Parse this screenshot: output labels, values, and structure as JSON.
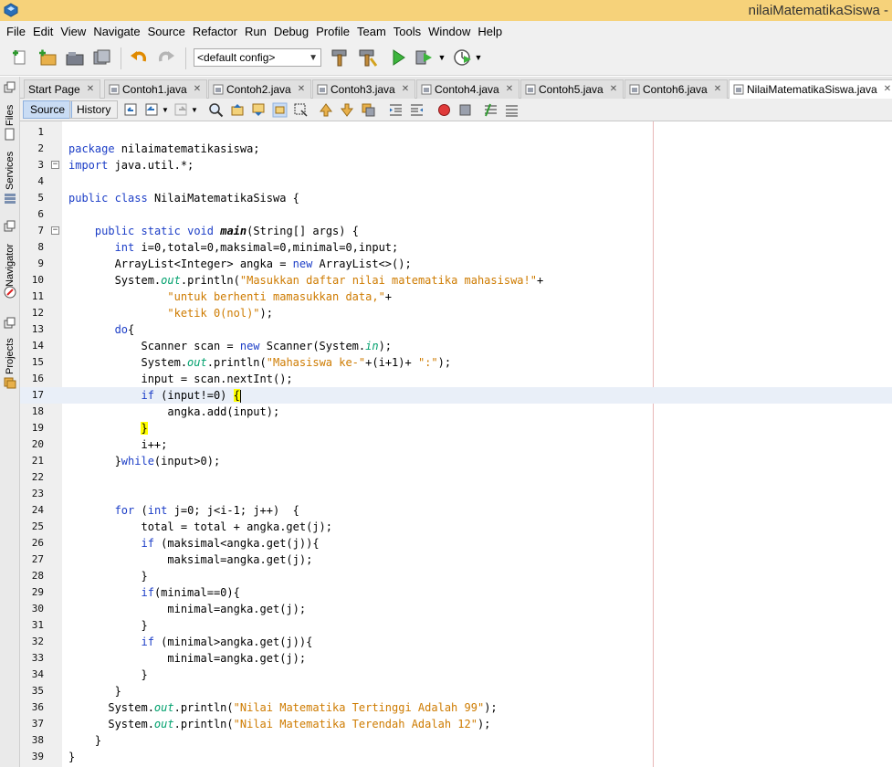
{
  "window": {
    "title": "nilaiMatematikaSiswa -"
  },
  "menu": [
    "File",
    "Edit",
    "View",
    "Navigate",
    "Source",
    "Refactor",
    "Run",
    "Debug",
    "Profile",
    "Team",
    "Tools",
    "Window",
    "Help"
  ],
  "toolbar": {
    "config_value": "<default config>"
  },
  "side_panels": [
    "Files",
    "Services",
    "Navigator",
    "Projects"
  ],
  "tabs": [
    {
      "label": "Start Page",
      "icon": "start-page-icon",
      "active": false
    },
    {
      "label": "Contoh1.java",
      "icon": "java-file-icon",
      "active": false
    },
    {
      "label": "Contoh2.java",
      "icon": "java-file-icon",
      "active": false
    },
    {
      "label": "Contoh3.java",
      "icon": "java-file-icon",
      "active": false
    },
    {
      "label": "Contoh4.java",
      "icon": "java-file-icon",
      "active": false
    },
    {
      "label": "Contoh5.java",
      "icon": "java-file-icon",
      "active": false
    },
    {
      "label": "Contoh6.java",
      "icon": "java-file-icon",
      "active": false
    },
    {
      "label": "NilaiMatematikaSiswa.java",
      "icon": "java-file-icon",
      "active": true
    }
  ],
  "editor_tabs": {
    "source": "Source",
    "history": "History"
  },
  "colors": {
    "keyword": "#1c3ec7",
    "string": "#ce7b00",
    "static_field": "#00a06d",
    "brace_highlight": "#ffff00",
    "title_bar": "#f6d27a",
    "current_line": "#e9eff8"
  },
  "code": {
    "current_line": 17,
    "lines": [
      "",
      "package nilaimatematikasiswa;",
      "import java.util.*;",
      "",
      "public class NilaiMatematikaSiswa {",
      "",
      "    public static void main(String[] args) {",
      "       int i=0,total=0,maksimal=0,minimal=0,input;",
      "       ArrayList<Integer> angka = new ArrayList<>();",
      "       System.out.println(\"Masukkan daftar nilai matematika mahasiswa!\"+",
      "               \"untuk berhenti mamasukkan data,\"+",
      "               \"ketik 0(nol)\");",
      "       do{",
      "           Scanner scan = new Scanner(System.in);",
      "           System.out.println(\"Mahasiswa ke-\"+(i+1)+ \":\");",
      "           input = scan.nextInt();",
      "           if (input!=0) {",
      "               angka.add(input);",
      "           }",
      "           i++;",
      "       }while(input>0);",
      "",
      "",
      "       for (int j=0; j<i-1; j++)  {",
      "           total = total + angka.get(j);",
      "           if (maksimal<angka.get(j)){",
      "               maksimal=angka.get(j);",
      "           }",
      "           if(minimal==0){",
      "               minimal=angka.get(j);",
      "           }",
      "           if (minimal>angka.get(j)){",
      "               minimal=angka.get(j);",
      "           }",
      "       }",
      "      System.out.println(\"Nilai Matematika Tertinggi Adalah 99\");",
      "      System.out.println(\"Nilai Matematika Terendah Adalah 12\");",
      "    }",
      "}"
    ]
  }
}
